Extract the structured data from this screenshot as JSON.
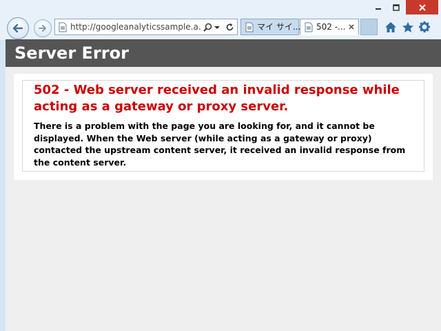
{
  "browser": {
    "address_url": "http://googleanalyticssample.a...",
    "tabs": [
      {
        "label": "マイ サイ..."
      },
      {
        "label": "502 -..."
      }
    ]
  },
  "page": {
    "header_title": "Server Error",
    "error_heading": "502 - Web server received an invalid response while acting as a gateway or proxy server.",
    "error_description": "There is a problem with the page you are looking for, and it cannot be displayed. When the Web server (while acting as a gateway or proxy) contacted the upstream content server, it received an invalid response from the content server."
  },
  "colors": {
    "header_bg": "#555555",
    "error_red": "#cc0000",
    "close_red": "#c7392b",
    "chrome": "#e8f1fa"
  },
  "icons": [
    "back-arrow-icon",
    "forward-arrow-icon",
    "page-icon",
    "search-icon",
    "chevron-down-icon",
    "refresh-icon",
    "close-icon",
    "home-icon",
    "star-icon",
    "gear-icon",
    "minimize-icon",
    "maximize-icon"
  ]
}
